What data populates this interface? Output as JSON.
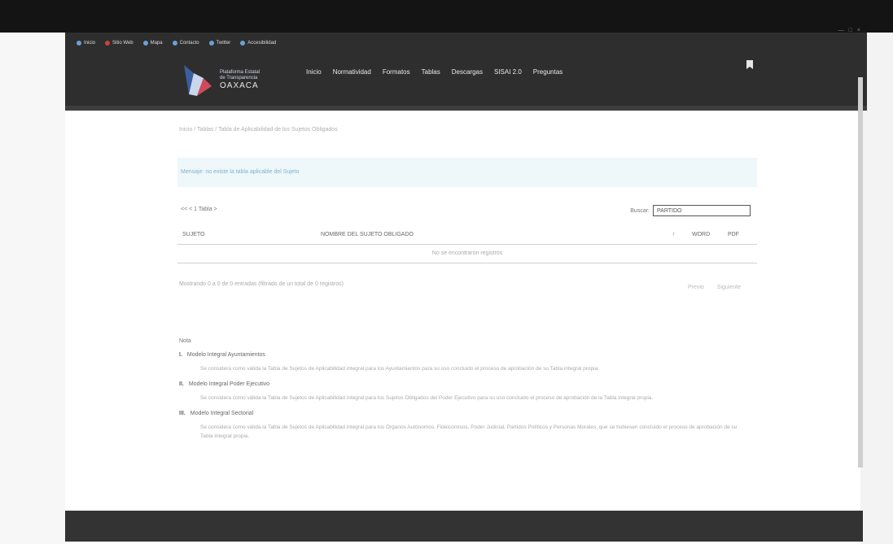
{
  "topbar": {
    "items": [
      {
        "label": "Inicio",
        "icon": "home-icon"
      },
      {
        "label": "Sitio Web",
        "icon": "globe-icon"
      },
      {
        "label": "Mapa",
        "icon": "map-icon"
      },
      {
        "label": "Contacto",
        "icon": "mail-icon"
      },
      {
        "label": "Twitter",
        "icon": "twitter-icon"
      },
      {
        "label": "Accesibilidad",
        "icon": "accessibility-icon"
      }
    ]
  },
  "brand": {
    "line1": "Plataforma Estatal",
    "line2": "de Transparencia",
    "line3": "OAXACA"
  },
  "nav": {
    "items": [
      "Inicio",
      "Normatividad",
      "Formatos",
      "Tablas",
      "Descargas",
      "SISAI 2.0",
      "Preguntas"
    ]
  },
  "breadcrumb": "Inicio / Tablas / Tabla de Aplicabilidad de los Sujetos Obligados",
  "alert": {
    "text": "Mensaje: no existe la tabla aplicable del Sujeto"
  },
  "pager_top": "<< < 1 Tabla >",
  "search": {
    "label": "Buscar:",
    "value": "PARTIDO"
  },
  "table": {
    "headers": [
      "SUJETO",
      "NOMBRE DEL SUJETO OBLIGADO",
      "↑",
      "WORD",
      "PDF"
    ],
    "empty_message": "No se encontraron registros"
  },
  "info": "Mostrando 0 a 0 de 0 entradas (filtrado de un total de 0 registros)",
  "pager_bottom": {
    "prev": "Previo",
    "next": "Siguiente"
  },
  "notes": {
    "title": "Nota",
    "items": [
      {
        "num": "I.",
        "head": "Modelo Integral Ayuntamientos",
        "body": "Se considera como válida la Tabla de Sujetos de Aplicabilidad integral para los Ayuntamientos para su uso concluido el proceso de aprobación de su Tabla integral propia."
      },
      {
        "num": "II.",
        "head": "Modelo Integral Poder Ejecutivo",
        "body": "Se considera como válida la Tabla de Sujetos de Aplicabilidad integral para los Sujetos Obligados del Poder Ejecutivo para su uso concluido el proceso de aprobación de la Tabla integral propia."
      },
      {
        "num": "III.",
        "head": "Modelo Integral Sectorial",
        "body": "Se considera como válida la Tabla de Sujetos de Aplicabilidad integral para los Órganos Autónomos, Fideicomisos, Poder Judicial, Partidos Políticos y Personas Morales, que se hubiesen concluido el proceso de aprobación de su Tabla integral propia."
      }
    ]
  },
  "window_controls": [
    "—",
    "□",
    "×"
  ]
}
